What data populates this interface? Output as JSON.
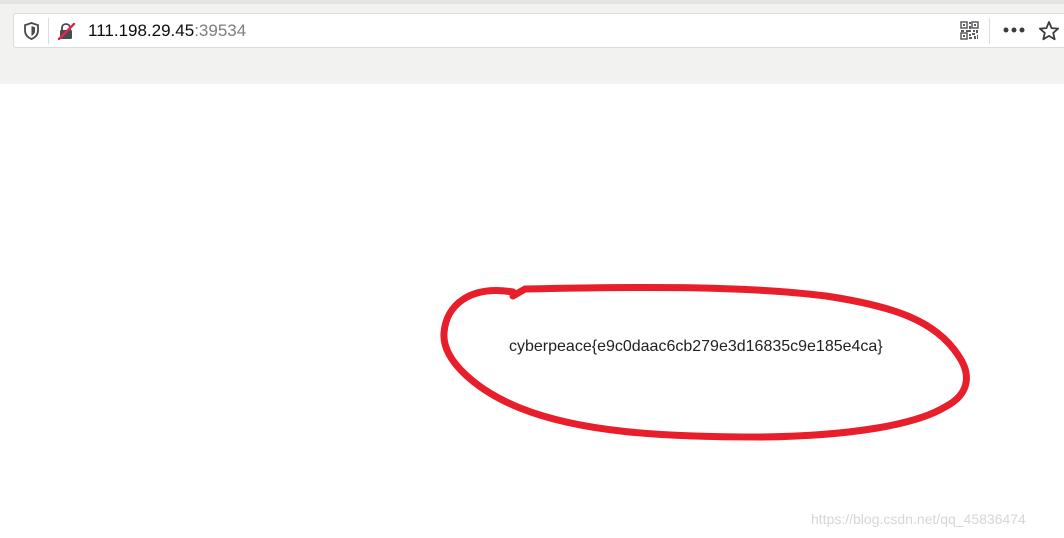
{
  "address_bar": {
    "host": "111.198.29.45",
    "port": ":39534",
    "icons": {
      "left": [
        "shield-icon",
        "insecure-lock-icon"
      ],
      "right": [
        "qr-code-icon",
        "more-menu-icon",
        "bookmark-star-icon"
      ]
    },
    "colors": {
      "insecure_slash": "#e2264d"
    }
  },
  "page": {
    "flag_text": "cyberpeace{e9c0daac6cb279e3d16835c9e185e4ca}",
    "annotation_color": "#e81e2a",
    "watermark": "https://blog.csdn.net/qq_45836474"
  }
}
